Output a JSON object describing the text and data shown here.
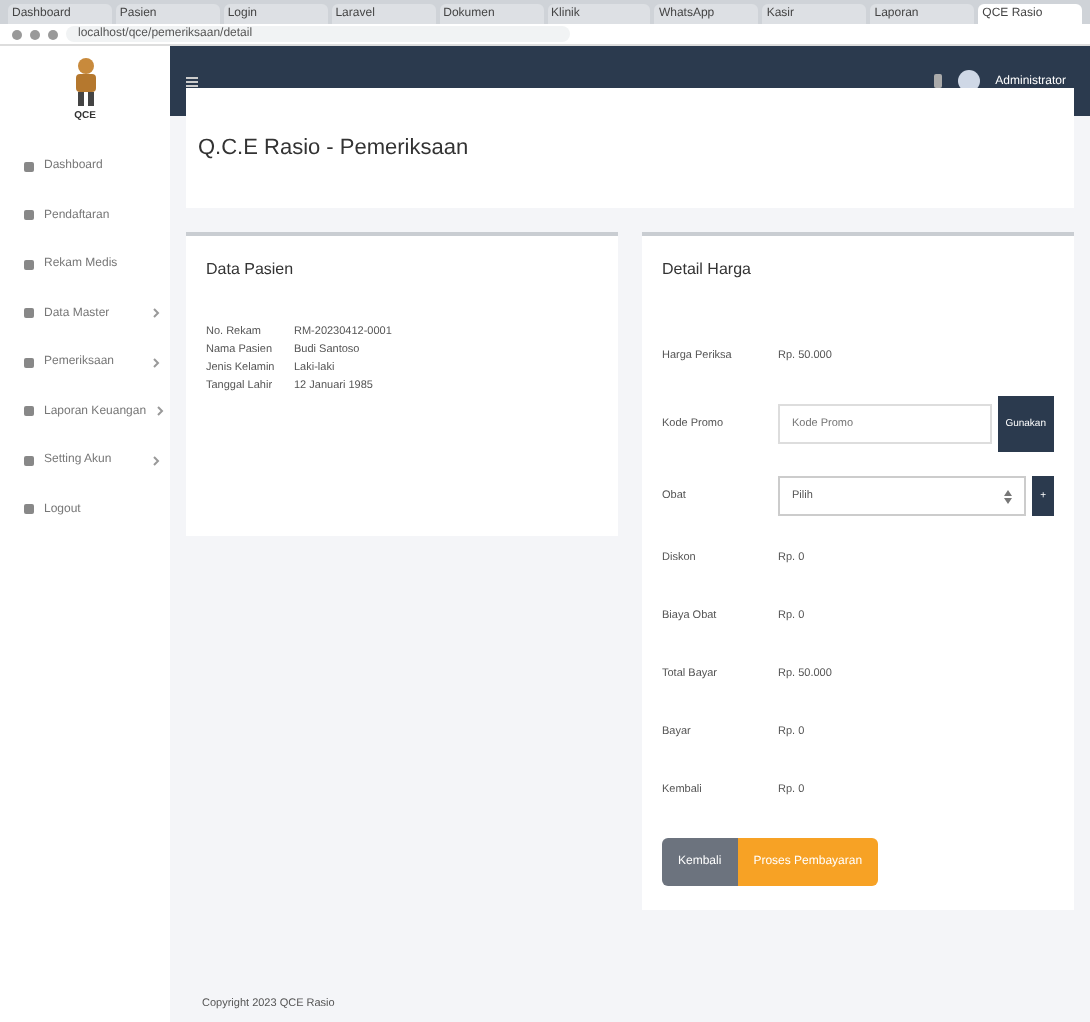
{
  "browser": {
    "tabs": [
      {
        "label": "Dashboard",
        "selected": false
      },
      {
        "label": "Pasien",
        "selected": false
      },
      {
        "label": "Login",
        "selected": false
      },
      {
        "label": "Laravel",
        "selected": false
      },
      {
        "label": "Dokumen",
        "selected": false
      },
      {
        "label": "Klinik",
        "selected": false
      },
      {
        "label": "WhatsApp",
        "selected": false
      },
      {
        "label": "Kasir",
        "selected": false
      },
      {
        "label": "Laporan",
        "selected": false
      },
      {
        "label": "QCE Rasio",
        "selected": true
      }
    ],
    "url": "localhost/qce/pemeriksaan/detail"
  },
  "sidebar": {
    "logo_caption": "QCE",
    "items": [
      {
        "label": "Dashboard",
        "has_children": false
      },
      {
        "label": "Pendaftaran",
        "has_children": false
      },
      {
        "label": "Rekam Medis",
        "has_children": false
      },
      {
        "label": "Data Master",
        "has_children": true
      },
      {
        "label": "Pemeriksaan",
        "has_children": true
      },
      {
        "label": "Laporan Keuangan",
        "has_children": true
      },
      {
        "label": "Setting Akun",
        "has_children": true
      },
      {
        "label": "Logout",
        "has_children": false
      }
    ]
  },
  "navbar": {
    "user": "Administrator"
  },
  "page_title": "Q.C.E Rasio - Pemeriksaan",
  "patient_card": {
    "title": "Data Pasien",
    "rows": [
      {
        "label": "No. Rekam",
        "value": "RM-20230412-0001"
      },
      {
        "label": "Nama Pasien",
        "value": "Budi Santoso"
      },
      {
        "label": "Jenis Kelamin",
        "value": "Laki-laki"
      },
      {
        "label": "Tanggal Lahir",
        "value": "12 Januari 1985"
      }
    ]
  },
  "price_card": {
    "title": "Detail Harga",
    "rows": [
      {
        "kind": "text",
        "label": "Harga Periksa",
        "value": "Rp. 50.000"
      },
      {
        "kind": "input",
        "label": "Kode Promo",
        "placeholder": "Kode Promo",
        "button": "Gunakan"
      },
      {
        "kind": "select",
        "label": "Obat",
        "value": "Pilih",
        "button": "+"
      },
      {
        "kind": "text",
        "label": "Diskon",
        "value": "Rp. 0"
      },
      {
        "kind": "text",
        "label": "Biaya Obat",
        "value": "Rp. 0"
      },
      {
        "kind": "text",
        "label": "Total Bayar",
        "value": "Rp. 50.000"
      },
      {
        "kind": "text",
        "label": "Bayar",
        "value": "Rp. 0"
      },
      {
        "kind": "text",
        "label": "Kembali",
        "value": "Rp. 0"
      }
    ],
    "buttons": [
      {
        "label": "Kembali",
        "kind": "secondary"
      },
      {
        "label": "Proses Pembayaran",
        "kind": "primary"
      }
    ]
  },
  "footer": "Copyright 2023 QCE Rasio"
}
